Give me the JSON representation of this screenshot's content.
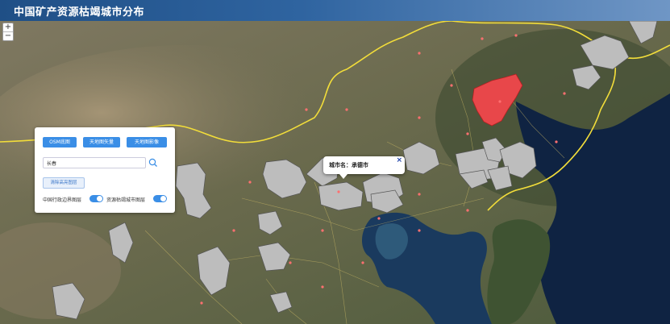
{
  "header": {
    "title": "中国矿产资源枯竭城市分布"
  },
  "zoom": {
    "in_label": "+",
    "out_label": "−"
  },
  "panel": {
    "buttons": [
      "OSM底图",
      "天地图矢量",
      "天地图影像"
    ],
    "search": {
      "value": "长春"
    },
    "clear_label": "清除高亮图层",
    "toggle_1_label": "中国行政边界图层",
    "toggle_2_label": "资源枯竭城市图层"
  },
  "popup": {
    "text": "城市名：承德市",
    "close": "×"
  },
  "colors": {
    "highlight": "#e8474a",
    "region": "#bdbdbd",
    "border": "#f2dd3a",
    "accent": "#3a8ee6"
  }
}
